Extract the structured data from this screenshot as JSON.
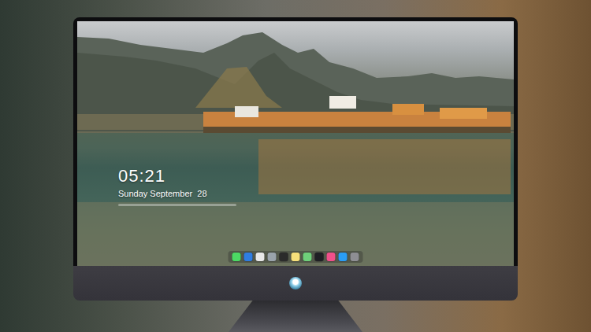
{
  "screen": {
    "clock": {
      "time": "05:21",
      "date": "Sunday September  28"
    }
  },
  "dock": {
    "items": [
      {
        "color": "#4cd964"
      },
      {
        "color": "#2f7de1"
      },
      {
        "color": "#e8e8e8"
      },
      {
        "color": "#9aa3ab"
      },
      {
        "color": "#2b2b2b"
      },
      {
        "color": "#f7e07a"
      },
      {
        "color": "#6fcf7a"
      },
      {
        "color": "#1f1f24"
      },
      {
        "color": "#f0508a"
      },
      {
        "color": "#2a9df4"
      },
      {
        "color": "#8e8e93"
      }
    ]
  }
}
